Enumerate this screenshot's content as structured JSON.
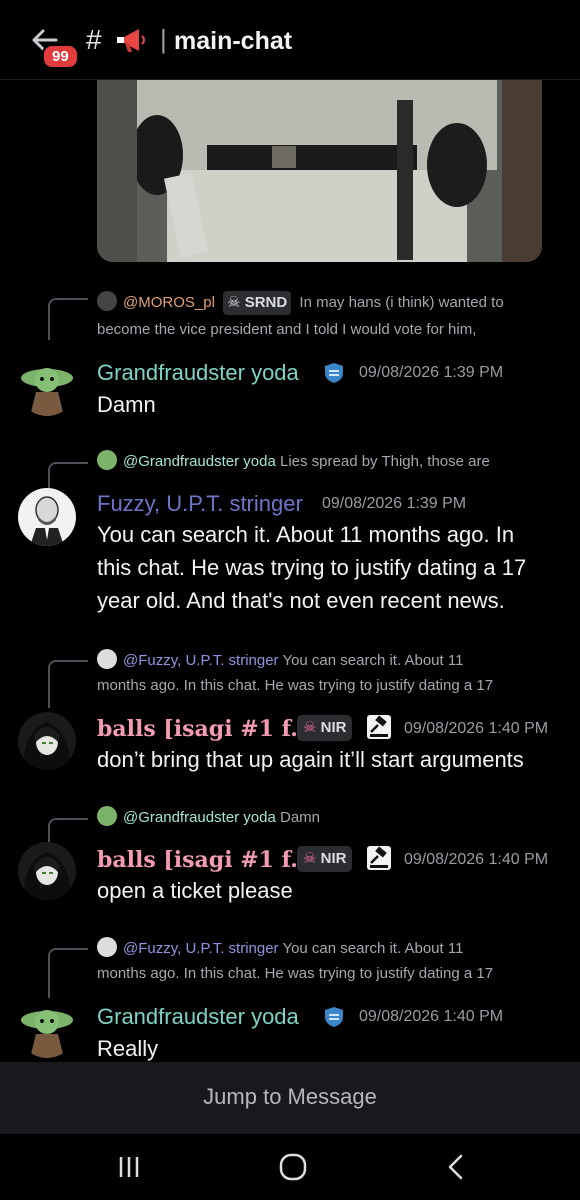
{
  "header": {
    "unread_badge": "99",
    "hash": "#",
    "separator": "|",
    "channel_name": "main-chat"
  },
  "messages": [
    {
      "reply_mention": "@MOROS_pl",
      "reply_tag": "SRND",
      "reply_line1": "In may hans (i think) wanted to",
      "reply_line2": "become the vice president and I told I would vote for him,",
      "author": "Grandfraudster yoda",
      "author_color": "#7fd3c5",
      "time": "09/08/2026 1:39 PM",
      "content": "Damn"
    },
    {
      "reply_mention": "@Grandfraudster yoda",
      "reply_line1": "Lies spread by Thigh, those are",
      "author": "Fuzzy, U.P.T. stringer",
      "author_color": "#6e74c8",
      "time": "09/08/2026 1:39 PM",
      "content_lines": [
        "You can search it. About 11 months ago. In",
        "this chat. He was trying to justify dating a 17",
        "year old. And that's not even recent news."
      ]
    },
    {
      "reply_mention": "@Fuzzy, U.P.T. stringer",
      "reply_line1": "You can search it. About 11",
      "reply_line2": "months ago. In this chat. He was trying to justify dating a 17",
      "author": "balls [isagi #1 f...",
      "author_color": "#f39bb0",
      "tag": "NIR",
      "time": "09/08/2026 1:40 PM",
      "content": "don’t bring that up again it’ll start arguments"
    },
    {
      "reply_mention": "@Grandfraudster yoda",
      "reply_line1": "Damn",
      "author": "balls [isagi #1 f...",
      "author_color": "#f39bb0",
      "tag": "NIR",
      "time": "09/08/2026 1:40 PM",
      "content": "open a ticket please"
    },
    {
      "reply_mention": "@Fuzzy, U.P.T. stringer",
      "reply_line1": "You can search it. About 11",
      "reply_line2": "months ago. In this chat. He was trying to justify dating a 17",
      "author": "Grandfraudster yoda",
      "author_color": "#7fd3c5",
      "time": "09/08/2026 1:40 PM",
      "content": "Really"
    }
  ],
  "jump_button": "Jump to Message",
  "icons": {
    "back": "back-arrow-icon",
    "megaphone": "megaphone-icon",
    "shield": "shield-role-icon",
    "skull": "skull-icon",
    "gavel": "gavel-icon",
    "nav_recent": "recent-apps-icon",
    "nav_home": "home-icon",
    "nav_back": "nav-back-icon"
  }
}
